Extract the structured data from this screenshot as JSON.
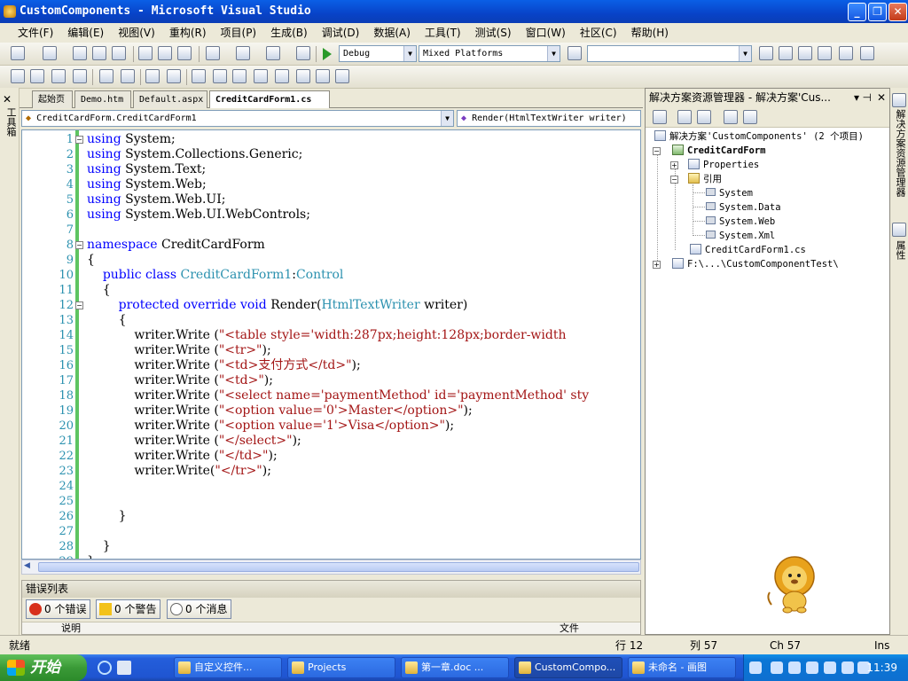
{
  "window": {
    "title": "CustomComponents - Microsoft Visual Studio"
  },
  "menu": [
    "文件(F)",
    "编辑(E)",
    "视图(V)",
    "重构(R)",
    "项目(P)",
    "生成(B)",
    "调试(D)",
    "数据(A)",
    "工具(T)",
    "测试(S)",
    "窗口(W)",
    "社区(C)",
    "帮助(H)"
  ],
  "toolbar": {
    "config": "Debug",
    "platform": "Mixed Platforms",
    "find": ""
  },
  "toolbox": {
    "label": "工具箱"
  },
  "tabs": [
    {
      "label": "起始页",
      "active": false
    },
    {
      "label": "Demo.htm",
      "active": false
    },
    {
      "label": "Default.aspx",
      "active": false
    },
    {
      "label": "CreditCardForm1.cs",
      "active": true
    }
  ],
  "nav": {
    "type": "CreditCardForm.CreditCardForm1",
    "member": "Render(HtmlTextWriter writer)"
  },
  "code": [
    {
      "n": "1",
      "t": [
        [
          "kw",
          "using"
        ],
        [
          "p",
          " System;"
        ]
      ]
    },
    {
      "n": "2",
      "t": [
        [
          "kw",
          "using"
        ],
        [
          "p",
          " System.Collections.Generic;"
        ]
      ]
    },
    {
      "n": "3",
      "t": [
        [
          "kw",
          "using"
        ],
        [
          "p",
          " System.Text;"
        ]
      ]
    },
    {
      "n": "4",
      "t": [
        [
          "kw",
          "using"
        ],
        [
          "p",
          " System.Web;"
        ]
      ]
    },
    {
      "n": "5",
      "t": [
        [
          "kw",
          "using"
        ],
        [
          "p",
          " System.Web.UI;"
        ]
      ]
    },
    {
      "n": "6",
      "t": [
        [
          "kw",
          "using"
        ],
        [
          "p",
          " System.Web.UI.WebControls;"
        ]
      ]
    },
    {
      "n": "7",
      "t": []
    },
    {
      "n": "8",
      "t": [
        [
          "kw",
          "namespace"
        ],
        [
          "p",
          " CreditCardForm"
        ]
      ]
    },
    {
      "n": "9",
      "t": [
        [
          "p",
          "{"
        ]
      ]
    },
    {
      "n": "10",
      "t": [
        [
          "p",
          "    "
        ],
        [
          "kw",
          "public"
        ],
        [
          "p",
          " "
        ],
        [
          "kw",
          "class"
        ],
        [
          "p",
          " "
        ],
        [
          "ty",
          "CreditCardForm1"
        ],
        [
          "p",
          ":"
        ],
        [
          "ty",
          "Control"
        ]
      ]
    },
    {
      "n": "11",
      "t": [
        [
          "p",
          "    {"
        ]
      ]
    },
    {
      "n": "12",
      "t": [
        [
          "p",
          "        "
        ],
        [
          "kw",
          "protected"
        ],
        [
          "p",
          " "
        ],
        [
          "kw",
          "override"
        ],
        [
          "p",
          " "
        ],
        [
          "kw",
          "void"
        ],
        [
          "p",
          " Render("
        ],
        [
          "ty",
          "HtmlTextWriter"
        ],
        [
          "p",
          " writer)"
        ]
      ]
    },
    {
      "n": "13",
      "t": [
        [
          "p",
          "        {"
        ]
      ]
    },
    {
      "n": "14",
      "t": [
        [
          "p",
          "            writer.Write ("
        ],
        [
          "st",
          "\"<table style='width:287px;height:128px;border-width"
        ]
      ]
    },
    {
      "n": "15",
      "t": [
        [
          "p",
          "            writer.Write ("
        ],
        [
          "st",
          "\"<tr>\""
        ],
        [
          "p",
          ");"
        ]
      ]
    },
    {
      "n": "16",
      "t": [
        [
          "p",
          "            writer.Write ("
        ],
        [
          "st",
          "\"<td>支付方式</td>\""
        ],
        [
          "p",
          ");"
        ]
      ]
    },
    {
      "n": "17",
      "t": [
        [
          "p",
          "            writer.Write ("
        ],
        [
          "st",
          "\"<td>\""
        ],
        [
          "p",
          ");"
        ]
      ]
    },
    {
      "n": "18",
      "t": [
        [
          "p",
          "            writer.Write ("
        ],
        [
          "st",
          "\"<select name='paymentMethod' id='paymentMethod' sty"
        ]
      ]
    },
    {
      "n": "19",
      "t": [
        [
          "p",
          "            writer.Write ("
        ],
        [
          "st",
          "\"<option value='0'>Master</option>\""
        ],
        [
          "p",
          ");"
        ]
      ]
    },
    {
      "n": "20",
      "t": [
        [
          "p",
          "            writer.Write ("
        ],
        [
          "st",
          "\"<option value='1'>Visa</option>\""
        ],
        [
          "p",
          ");"
        ]
      ]
    },
    {
      "n": "21",
      "t": [
        [
          "p",
          "            writer.Write ("
        ],
        [
          "st",
          "\"</select>\""
        ],
        [
          "p",
          ");"
        ]
      ]
    },
    {
      "n": "22",
      "t": [
        [
          "p",
          "            writer.Write ("
        ],
        [
          "st",
          "\"</td>\""
        ],
        [
          "p",
          ");"
        ]
      ]
    },
    {
      "n": "23",
      "t": [
        [
          "p",
          "            writer.Write("
        ],
        [
          "st",
          "\"</tr>\""
        ],
        [
          "p",
          ");"
        ]
      ]
    },
    {
      "n": "24",
      "t": []
    },
    {
      "n": "25",
      "t": []
    },
    {
      "n": "26",
      "t": [
        [
          "p",
          "        }"
        ]
      ]
    },
    {
      "n": "27",
      "t": []
    },
    {
      "n": "28",
      "t": [
        [
          "p",
          "    }"
        ]
      ]
    },
    {
      "n": "29",
      "t": [
        [
          "p",
          "}"
        ]
      ]
    }
  ],
  "errors": {
    "title": "错误列表",
    "errors_label": "0 个错误",
    "warnings_label": "0 个警告",
    "messages_label": "0 个消息",
    "col_desc": "说明",
    "col_file": "文件"
  },
  "solution": {
    "title": "解决方案资源管理器 - 解决方案'Cus...",
    "root": "解决方案'CustomComponents' (2 个项目)",
    "project": "CreditCardForm",
    "properties": "Properties",
    "references": "引用",
    "refs": [
      "System",
      "System.Data",
      "System.Web",
      "System.Xml"
    ],
    "file": "CreditCardForm1.cs",
    "other_project": "F:\\...\\CustomComponentTest\\"
  },
  "right_strip": {
    "solution_label": "解决方案资源管理器",
    "props_label": "属性"
  },
  "status": {
    "state": "就绪",
    "line": "行 12",
    "col": "列 57",
    "ch": "Ch 57",
    "mode": "Ins"
  },
  "taskbar": {
    "start": "开始",
    "tasks": [
      "自定义控件...",
      "Projects",
      "第一章.doc ...",
      "CustomCompo...",
      "未命名 - 画图"
    ],
    "clock": "11:39"
  },
  "colors": {
    "keyword": "#0000ff",
    "type": "#2b91af",
    "string": "#a31515",
    "linenum": "#2b91af"
  }
}
